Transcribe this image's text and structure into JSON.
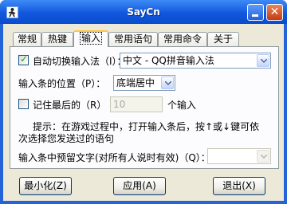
{
  "window": {
    "title": "SayCn",
    "minimize_glyph": "",
    "close_glyph": "✕"
  },
  "tabs": [
    {
      "label": "常规"
    },
    {
      "label": "热键"
    },
    {
      "label": "输入"
    },
    {
      "label": "常用语句"
    },
    {
      "label": "常用命令"
    },
    {
      "label": "关于"
    }
  ],
  "active_tab": "输入",
  "input_tab": {
    "auto_switch": {
      "label": "自动切换输入法（I）：",
      "checked": true,
      "ime_value": "中文 - QQ拼音输入法"
    },
    "bar_position": {
      "label": "输入条的位置（P）：",
      "value": "底端居中"
    },
    "remember_last": {
      "label": "记住最后的（R）",
      "checked": false,
      "count_value": "10",
      "suffix": "个输入"
    },
    "hint_line1": "提示：在游戏过程中，打开输入条后，按↑或↓键可依",
    "hint_line2": "次选择您发送过的语句",
    "reserved_text": {
      "label": "输入条中预留文字(对所有人说时有效)（Q）：",
      "value": ""
    }
  },
  "buttons": {
    "minimize": "最小化(Z)",
    "apply": "应用(A)",
    "exit": "退出(X)"
  }
}
